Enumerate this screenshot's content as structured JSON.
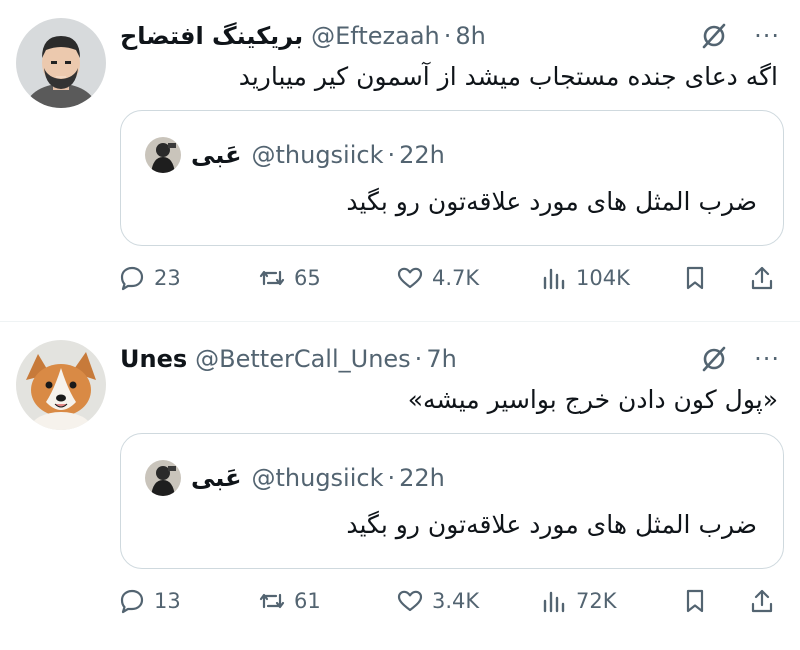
{
  "tweets": [
    {
      "name": "بریکینگ افتضاح",
      "handle": "@Eftezaah",
      "time": "8h",
      "text": "اگه دعای جنده مستجاب میشد از آسمون کیر میبارید",
      "quote": {
        "name": "عَبی",
        "handle": "@thugsiick",
        "time": "22h",
        "text": "ضرب المثل های مورد علاقه‌تون رو بگید"
      },
      "stats": {
        "replies": "23",
        "retweets": "65",
        "likes": "4.7K",
        "views": "104K"
      }
    },
    {
      "name": "Unes",
      "handle": "@BetterCall_Unes",
      "time": "7h",
      "text": "«پول کون دادن خرج بواسیر میشه»",
      "quote": {
        "name": "عَبی",
        "handle": "@thugsiick",
        "time": "22h",
        "text": "ضرب المثل های مورد علاقه‌تون رو بگید"
      },
      "stats": {
        "replies": "13",
        "retweets": "61",
        "likes": "3.4K",
        "views": "72K"
      }
    }
  ],
  "separator": "·",
  "more_label": "···",
  "icons": [
    "grok-icon",
    "more-icon",
    "reply-icon",
    "retweet-icon",
    "like-icon",
    "views-icon",
    "bookmark-icon",
    "share-icon"
  ],
  "colors": {
    "text": "#0f1419",
    "secondary": "#536471",
    "border": "#cfd9de",
    "divider": "#eff3f4"
  }
}
